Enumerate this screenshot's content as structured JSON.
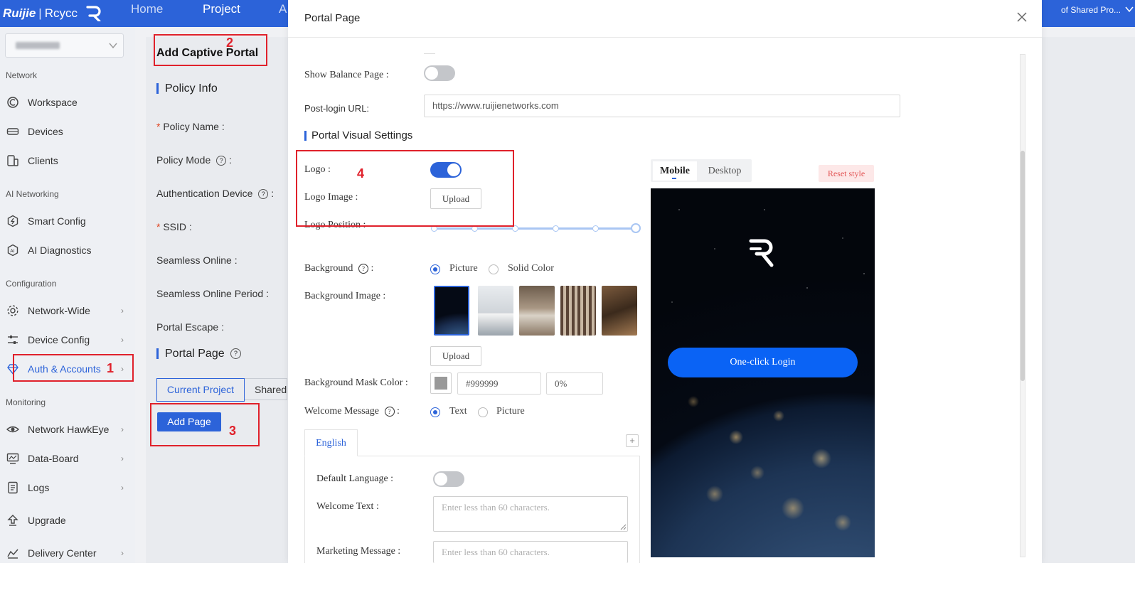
{
  "topbar": {
    "brand": "Ruijie",
    "brand_sep": "|",
    "brand_name": "Rcycc",
    "nav": [
      "Home",
      "Project",
      "A"
    ],
    "project_selector": "of Shared Pro..."
  },
  "sidebar": {
    "sections": {
      "network": "Network",
      "ai_networking": "AI Networking",
      "configuration": "Configuration",
      "monitoring": "Monitoring"
    },
    "items": [
      {
        "label": "Workspace",
        "icon": "workspace-icon",
        "arrow": false
      },
      {
        "label": "Devices",
        "icon": "devices-icon",
        "arrow": false
      },
      {
        "label": "Clients",
        "icon": "clients-icon",
        "arrow": false
      },
      {
        "label": "Smart Config",
        "icon": "smart-config-icon",
        "arrow": false
      },
      {
        "label": "AI Diagnostics",
        "icon": "ai-diagnostics-icon",
        "arrow": false
      },
      {
        "label": "Network-Wide",
        "icon": "gear-icon",
        "arrow": true
      },
      {
        "label": "Device Config",
        "icon": "sliders-icon",
        "arrow": true
      },
      {
        "label": "Auth & Accounts",
        "icon": "diamond-icon",
        "arrow": true,
        "active": true
      },
      {
        "label": "Network HawkEye",
        "icon": "eye-icon",
        "arrow": true
      },
      {
        "label": "Data-Board",
        "icon": "monitor-icon",
        "arrow": true
      },
      {
        "label": "Logs",
        "icon": "logs-icon",
        "arrow": true
      },
      {
        "label": "Upgrade",
        "icon": "upgrade-icon",
        "arrow": false
      },
      {
        "label": "Delivery Center",
        "icon": "delivery-icon",
        "arrow": true
      }
    ]
  },
  "background_page": {
    "title": "Add Captive Portal",
    "policy_info": "Policy Info",
    "fields": {
      "policy_name": "Policy Name",
      "policy_mode": "Policy Mode",
      "auth_device": "Authentication Device",
      "ssid": "SSID",
      "seamless_online": "Seamless Online",
      "seamless_period": "Seamless Online Period",
      "portal_escape": "Portal Escape"
    },
    "colon": ":",
    "asterisk": "*",
    "portal_page": "Portal Page",
    "tabs": [
      "Current Project",
      "Shared"
    ],
    "add_page": "Add Page"
  },
  "annotations": [
    "1",
    "2",
    "3",
    "4"
  ],
  "modal": {
    "title": "Portal Page",
    "close": "×",
    "show_balance_label": "Show Balance Page :",
    "show_balance_on": false,
    "post_login_label": "Post-login URL:",
    "post_login_value": "https://www.ruijienetworks.com",
    "visual_settings": "Portal Visual Settings",
    "logo_label": "Logo :",
    "logo_on": true,
    "logo_image_label": "Logo Image :",
    "upload": "Upload",
    "logo_position_label": "Logo Position :",
    "background_label": "Background",
    "background_colon": ":",
    "bg_options": [
      "Picture",
      "Solid Color"
    ],
    "bg_selected": "Picture",
    "background_image_label": "Background Image :",
    "bg_upload": "Upload",
    "mask_color_label": "Background Mask Color :",
    "mask_color_value": "#999999",
    "mask_opacity_value": "0%",
    "welcome_label": "Welcome Message",
    "welcome_colon": ":",
    "welcome_options": [
      "Text",
      "Picture"
    ],
    "welcome_selected": "Text",
    "lang_tab": "English",
    "lang_add": "+",
    "default_language_label": "Default Language :",
    "default_language_on": false,
    "welcome_text_label": "Welcome Text :",
    "welcome_text_placeholder": "Enter less than 60 characters.",
    "marketing_label": "Marketing Message :",
    "marketing_placeholder": "Enter less than 60 characters."
  },
  "preview": {
    "tabs": [
      "Mobile",
      "Desktop"
    ],
    "active_tab": "Mobile",
    "reset_style": "Reset style",
    "login_button": "One-click Login"
  },
  "colors": {
    "brand_blue": "#2c63d9",
    "annotation_red": "#e0212b",
    "login_blue": "#0a63f5"
  }
}
